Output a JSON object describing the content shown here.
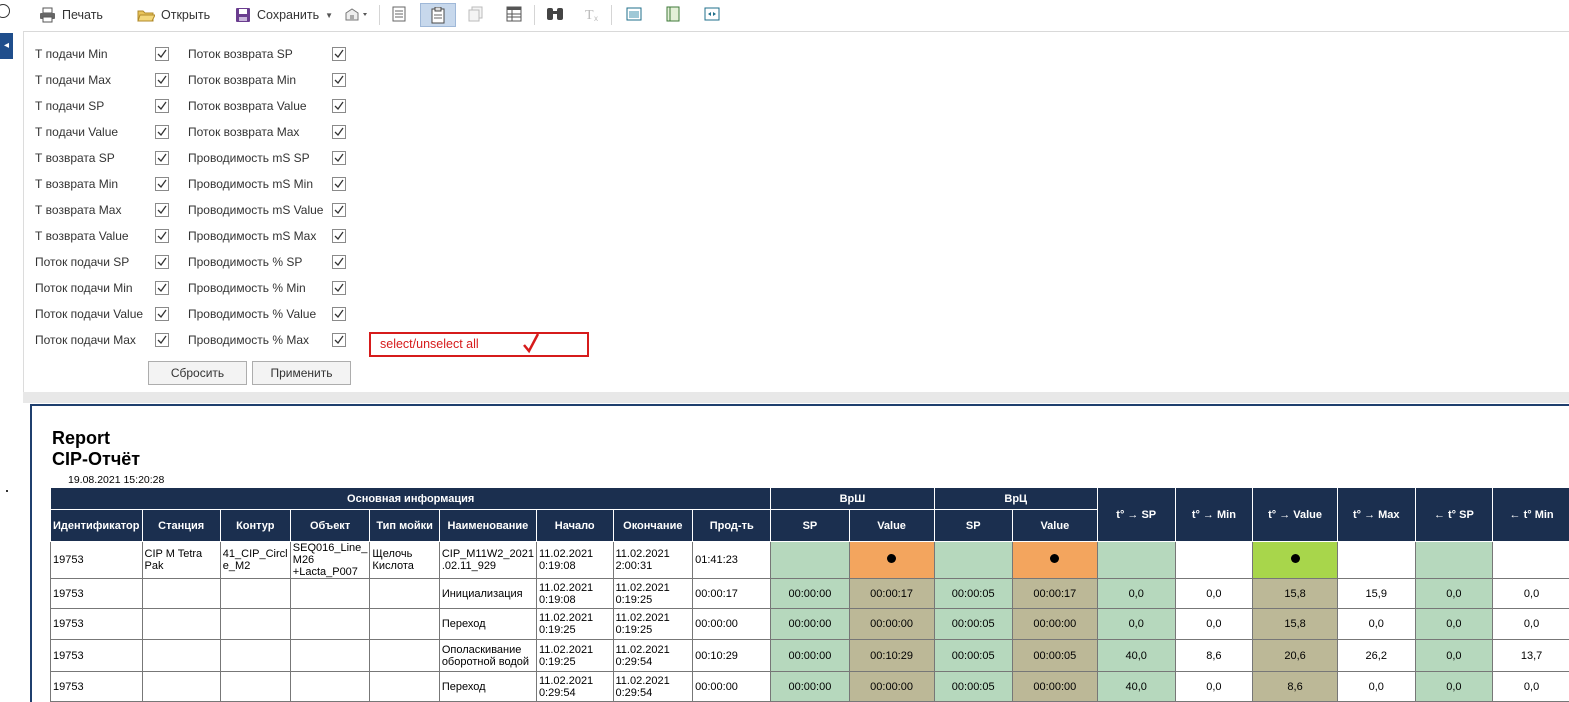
{
  "toolbar": {
    "print_label": "Печать",
    "open_label": "Открыть",
    "save_label": "Сохранить"
  },
  "filters": {
    "col1": [
      "Т подачи Min",
      "Т подачи Max",
      "Т подачи SP",
      "Т подачи Value",
      "Т возврата SP",
      "Т возврата Min",
      "Т возврата Max",
      "Т возврата Value",
      "Поток подачи SP",
      "Поток подачи Min",
      "Поток подачи Value",
      "Поток подачи Max"
    ],
    "col2": [
      "Поток возврата SP",
      "Поток возврата Min",
      "Поток возврата Value",
      "Поток возврата Max",
      "Проводимость mS SP",
      "Проводимость mS Min",
      "Проводимость mS Value",
      "Проводимость mS Max",
      "Проводимость % SP",
      "Проводимость % Min",
      "Проводимость % Value",
      "Проводимость % Max"
    ],
    "reset_label": "Сбросить",
    "apply_label": "Применить",
    "annotation": "select/unselect all"
  },
  "report": {
    "title_line1": "Report",
    "title_line2": "CIP-Отчёт",
    "date": "19.08.2021 15:20:28",
    "group_headers": {
      "main": "Основная информация",
      "vrsh": "ВрШ",
      "vrc": "ВрЦ"
    },
    "columns": [
      "Идентификатор",
      "Станция",
      "Контур",
      "Объект",
      "Тип мойки",
      "Наименование",
      "Начало",
      "Окончание",
      "Прод-ть",
      "SP",
      "Value",
      "SP",
      "Value",
      "t° → SP",
      "t° → Min",
      "t° → Value",
      "t° → Max",
      "← t° SP",
      "← t° Min"
    ],
    "rows": [
      [
        "19753",
        "CIP M Tetra Pak",
        "41_CIP_Circl e_M2",
        "SEQ016_Line_ M26 +Lacta_P007",
        "Щелочь Кислота",
        "CIP_M11W2_2021 .02.11_929",
        "11.02.2021 0:19:08",
        "11.02.2021 2:00:31",
        "01:41:23",
        "",
        "●",
        "",
        "●",
        "",
        "",
        "●",
        "",
        "",
        ""
      ],
      [
        "19753",
        "",
        "",
        "",
        "",
        "Инициализация",
        "11.02.2021 0:19:08",
        "11.02.2021 0:19:25",
        "00:00:17",
        "00:00:00",
        "00:00:17",
        "00:00:05",
        "00:00:17",
        "0,0",
        "0,0",
        "15,8",
        "15,9",
        "0,0",
        "0,0"
      ],
      [
        "19753",
        "",
        "",
        "",
        "",
        "Переход",
        "11.02.2021 0:19:25",
        "11.02.2021 0:19:25",
        "00:00:00",
        "00:00:00",
        "00:00:00",
        "00:00:05",
        "00:00:00",
        "0,0",
        "0,0",
        "15,8",
        "0,0",
        "0,0",
        "0,0"
      ],
      [
        "19753",
        "",
        "",
        "",
        "",
        "Ополаскивание оборотной водой",
        "11.02.2021 0:19:25",
        "11.02.2021 0:29:54",
        "00:10:29",
        "00:00:00",
        "00:10:29",
        "00:00:05",
        "00:00:05",
        "40,0",
        "8,6",
        "20,6",
        "26,2",
        "0,0",
        "13,7"
      ],
      [
        "19753",
        "",
        "",
        "",
        "",
        "Переход",
        "11.02.2021 0:29:54",
        "11.02.2021 0:29:54",
        "00:00:00",
        "00:00:00",
        "00:00:00",
        "00:00:05",
        "00:00:00",
        "40,0",
        "0,0",
        "8,6",
        "0,0",
        "0,0",
        "0,0"
      ]
    ],
    "row_colors": [
      [
        "",
        "",
        "",
        "",
        "",
        "",
        "",
        "",
        "",
        "g",
        "o",
        "g",
        "o",
        "g",
        "",
        "lg",
        "",
        "g",
        ""
      ],
      [
        "",
        "",
        "",
        "",
        "",
        "",
        "",
        "",
        "",
        "g",
        "k",
        "g",
        "k",
        "g",
        "",
        "k",
        "",
        "g",
        ""
      ],
      [
        "",
        "",
        "",
        "",
        "",
        "",
        "",
        "",
        "",
        "g",
        "k",
        "g",
        "k",
        "g",
        "",
        "k",
        "",
        "g",
        ""
      ],
      [
        "",
        "",
        "",
        "",
        "",
        "",
        "",
        "",
        "",
        "g",
        "k",
        "g",
        "k",
        "g",
        "",
        "k",
        "",
        "g",
        ""
      ],
      [
        "",
        "",
        "",
        "",
        "",
        "",
        "",
        "",
        "",
        "g",
        "k",
        "g",
        "k",
        "g",
        "",
        "k",
        "",
        "g",
        ""
      ]
    ]
  }
}
